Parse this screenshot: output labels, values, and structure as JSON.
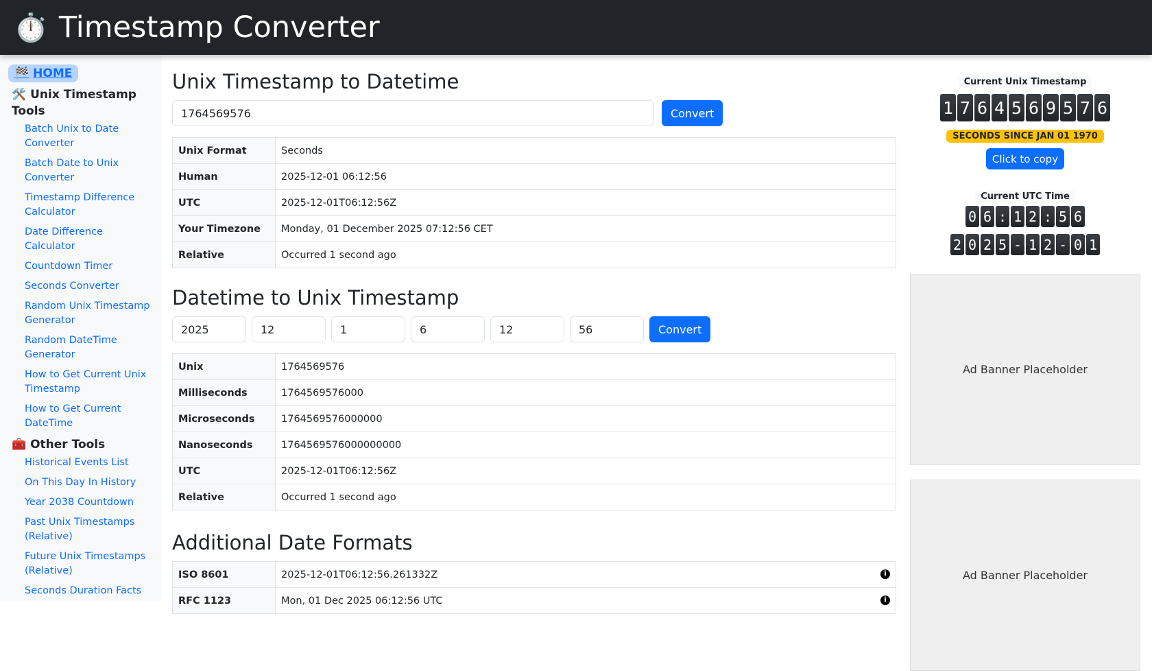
{
  "header": {
    "title": "Timestamp Converter"
  },
  "sidebar": {
    "home": "HOME",
    "unix_section": "Unix Timestamp Tools",
    "unix_links": [
      "Batch Unix to Date Converter",
      "Batch Date to Unix Converter",
      "Timestamp Difference Calculator",
      "Date Difference Calculator",
      "Countdown Timer",
      "Seconds Converter",
      "Random Unix Timestamp Generator",
      "Random DateTime Generator",
      "How to Get Current Unix Timestamp",
      "How to Get Current DateTime"
    ],
    "other_section": "Other Tools",
    "other_links": [
      "Historical Events List",
      "On This Day In History",
      "Year 2038 Countdown",
      "Past Unix Timestamps (Relative)",
      "Future Unix Timestamps (Relative)",
      "Seconds Duration Facts"
    ]
  },
  "unix_to_date": {
    "title": "Unix Timestamp to Datetime",
    "input": "1764569576",
    "convert": "Convert",
    "rows": [
      [
        "Unix Format",
        "Seconds"
      ],
      [
        "Human",
        "2025-12-01 06:12:56"
      ],
      [
        "UTC",
        "2025-12-01T06:12:56Z"
      ],
      [
        "Your Timezone",
        "Monday, 01 December 2025 07:12:56 CET"
      ],
      [
        "Relative",
        "Occurred 1 second ago"
      ]
    ]
  },
  "date_to_unix": {
    "title": "Datetime to Unix Timestamp",
    "inputs": [
      "2025",
      "12",
      "1",
      "6",
      "12",
      "56"
    ],
    "convert": "Convert",
    "rows": [
      [
        "Unix",
        "1764569576"
      ],
      [
        "Milliseconds",
        "1764569576000"
      ],
      [
        "Microseconds",
        "1764569576000000"
      ],
      [
        "Nanoseconds",
        "1764569576000000000"
      ],
      [
        "UTC",
        "2025-12-01T06:12:56Z"
      ],
      [
        "Relative",
        "Occurred 1 second ago"
      ]
    ]
  },
  "additional": {
    "title": "Additional Date Formats",
    "rows": [
      [
        "ISO 8601",
        "2025-12-01T06:12:56.261332Z"
      ],
      [
        "RFC 1123",
        "Mon, 01 Dec 2025 06:12:56 UTC"
      ]
    ]
  },
  "right": {
    "unix_label": "Current Unix Timestamp",
    "unix_digits": [
      "1",
      "7",
      "6",
      "4",
      "5",
      "6",
      "9",
      "5",
      "7",
      "6"
    ],
    "badge": "SECONDS SINCE JAN 01 1970",
    "copy": "Click to copy",
    "utc_label": "Current UTC Time",
    "time_digits": [
      "0",
      "6",
      ":",
      "1",
      "2",
      ":",
      "5",
      "6"
    ],
    "date_digits": [
      "2",
      "0",
      "2",
      "5",
      "-",
      "1",
      "2",
      "-",
      "0",
      "1"
    ],
    "ad1": "Ad Banner Placeholder",
    "ad2": "Ad Banner Placeholder"
  }
}
